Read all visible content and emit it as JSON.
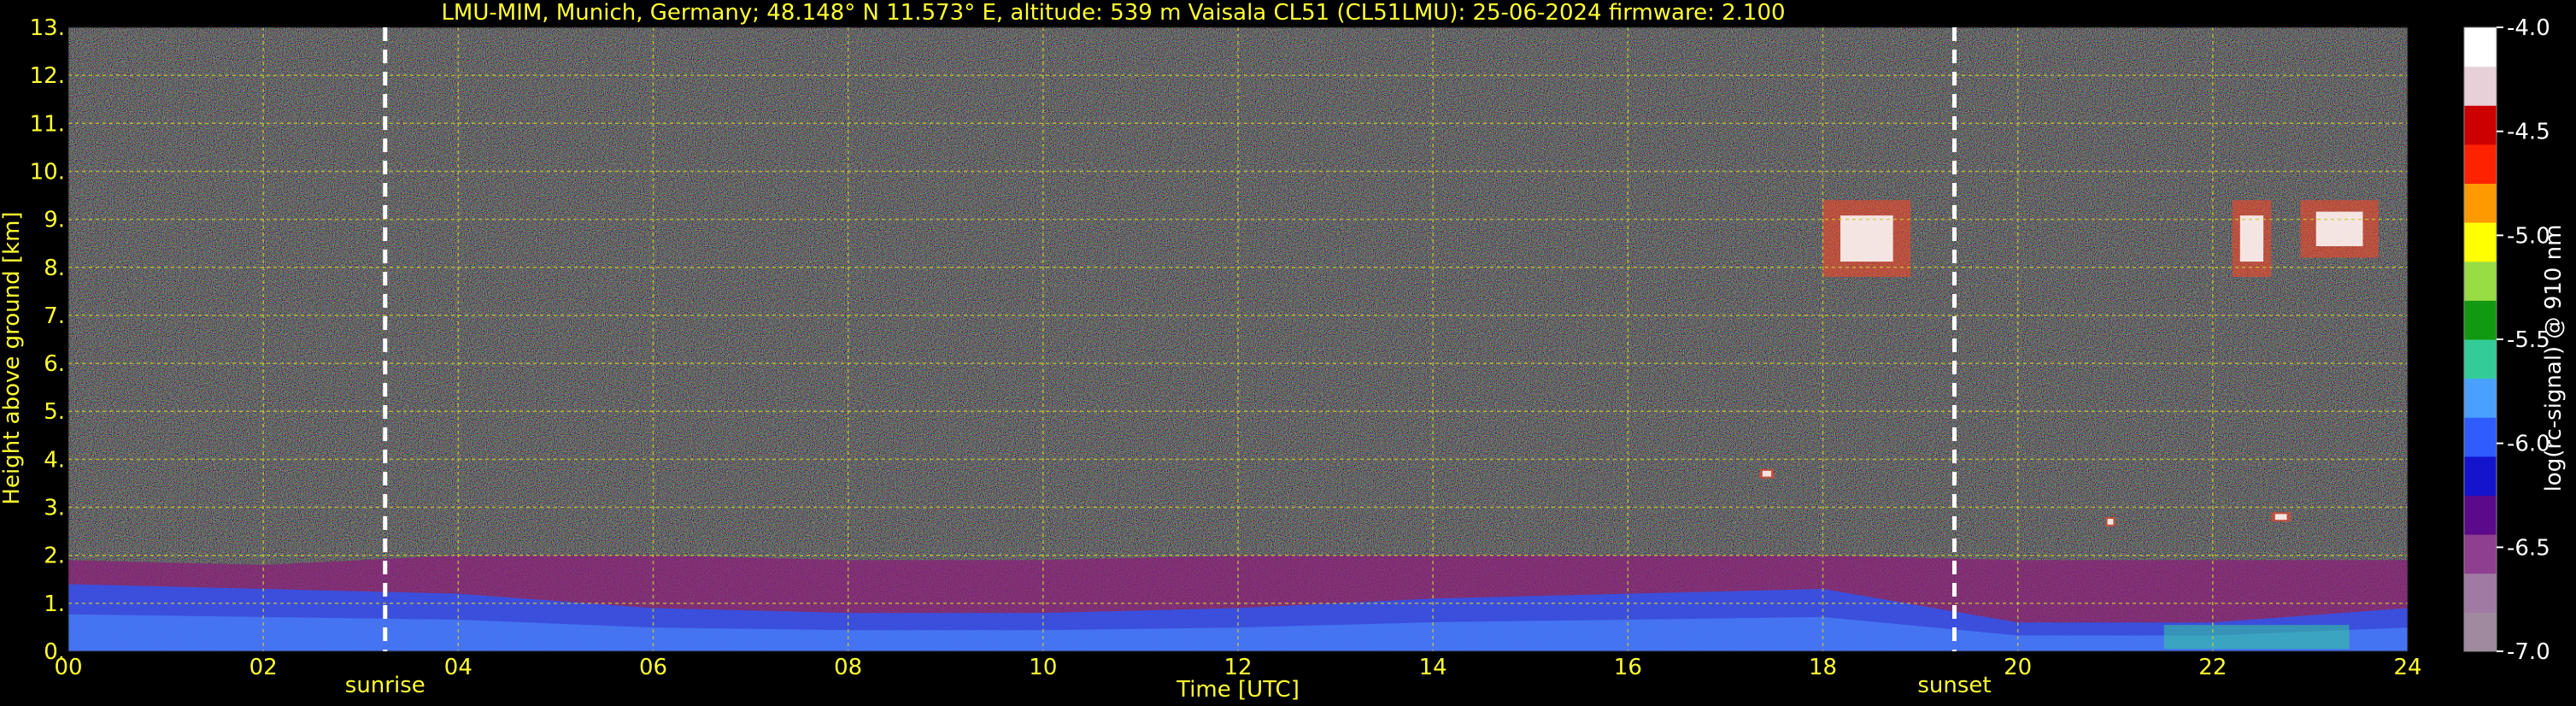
{
  "chart_data": {
    "type": "heatmap",
    "title": "LMU-MIM, Munich, Germany; 48.148° N 11.573° E, altitude: 539 m    Vaisala CL51 (CL51LMU): 25-06-2024    firmware: 2.100",
    "xlabel": "Time [UTC]",
    "ylabel": "Height above ground [km]",
    "xlim": [
      0,
      24
    ],
    "ylim": [
      0,
      13
    ],
    "x_ticks": [
      "00",
      "02",
      "04",
      "06",
      "08",
      "10",
      "12",
      "14",
      "16",
      "18",
      "20",
      "22",
      "24"
    ],
    "y_ticks": [
      "0.",
      "1.",
      "2.",
      "3.",
      "4.",
      "5.",
      "6.",
      "7.",
      "8.",
      "9.",
      "10.",
      "11.",
      "12.",
      "13."
    ],
    "grid": true,
    "colorbar": {
      "label": "log(rc-signal) @ 910 nm",
      "range": [
        -7.0,
        -4.0
      ],
      "ticks": [
        "-4.0",
        "-4.5",
        "-5.0",
        "-5.5",
        "-6.0",
        "-6.5",
        "-7.0"
      ]
    },
    "markers": [
      {
        "label": "sunrise",
        "time": 3.25
      },
      {
        "label": "sunset",
        "time": 19.35
      }
    ],
    "layers": [
      {
        "feature": "aerosol boundary layer top",
        "times": [
          0,
          2,
          4,
          6,
          8,
          10,
          12,
          14,
          16,
          18,
          20,
          22,
          24
        ],
        "height_km": [
          1.9,
          1.8,
          2.0,
          2.0,
          1.9,
          1.9,
          2.0,
          2.0,
          2.0,
          2.0,
          1.9,
          1.9,
          1.9
        ]
      },
      {
        "feature": "mixing layer top",
        "times": [
          0,
          2,
          4,
          6,
          8,
          10,
          12,
          14,
          16,
          18,
          20,
          22,
          24
        ],
        "height_km": [
          1.4,
          1.3,
          1.2,
          0.9,
          0.8,
          0.8,
          0.9,
          1.1,
          1.2,
          1.3,
          0.6,
          0.6,
          0.9
        ]
      }
    ],
    "clouds": [
      {
        "start": 18.0,
        "end": 18.9,
        "base_km": 7.8,
        "top_km": 9.4
      },
      {
        "start": 22.2,
        "end": 22.6,
        "base_km": 7.8,
        "top_km": 9.4
      },
      {
        "start": 22.9,
        "end": 23.7,
        "base_km": 8.2,
        "top_km": 9.4
      },
      {
        "start": 17.35,
        "end": 17.5,
        "base_km": 3.6,
        "top_km": 3.8
      },
      {
        "start": 20.9,
        "end": 21.0,
        "base_km": 2.6,
        "top_km": 2.8
      },
      {
        "start": 22.6,
        "end": 22.8,
        "base_km": 2.7,
        "top_km": 2.9
      }
    ]
  },
  "colors": {
    "text": "#ffff33",
    "grid": "#cccc33",
    "marker": "#ffffff",
    "colormap": [
      "#9f8a9f",
      "#a07aa3",
      "#8f3f8f",
      "#5a0a8a",
      "#1414cc",
      "#2e5cff",
      "#4aa0ff",
      "#33cc99",
      "#119911",
      "#99dd44",
      "#ffff00",
      "#ff9900",
      "#ff2200",
      "#cc0000",
      "#e8d0d8",
      "#ffffff"
    ]
  }
}
